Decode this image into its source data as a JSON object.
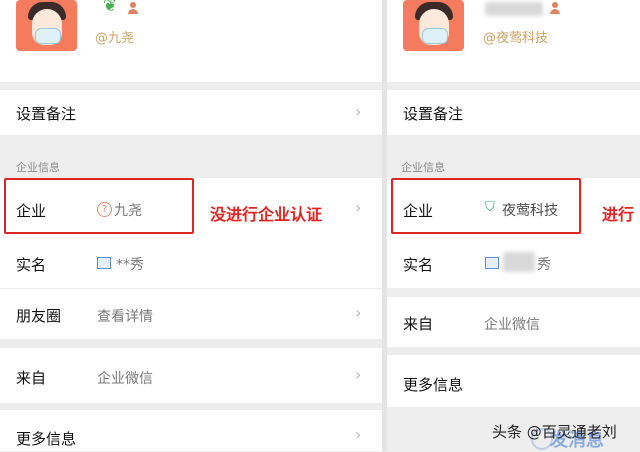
{
  "left": {
    "handle": "@九尧",
    "remark_label": "设置备注",
    "section_title": "企业信息",
    "enterprise_label": "企业",
    "enterprise_value": "九尧",
    "annotation": "没进行企业认证",
    "realname_label": "实名",
    "realname_value": "**秀",
    "moments_label": "朋友圈",
    "moments_value": "查看详情",
    "from_label": "来自",
    "from_value": "企业微信",
    "more_label": "更多信息"
  },
  "right": {
    "handle": "@夜莺科技",
    "remark_label": "设置备注",
    "section_title": "企业信息",
    "enterprise_label": "企业",
    "enterprise_value": "夜莺科技",
    "annotation": "进行",
    "realname_label": "实名",
    "realname_value": "秀",
    "from_label": "来自",
    "from_value": "企业微信",
    "more_label": "更多信息",
    "watermark_partial": "发消息"
  },
  "watermark": "头条 @百灵通老刘",
  "colors": {
    "annotation_red": "#e02424",
    "verified_green": "#3aa66a",
    "handle_gold": "#c9a263"
  }
}
